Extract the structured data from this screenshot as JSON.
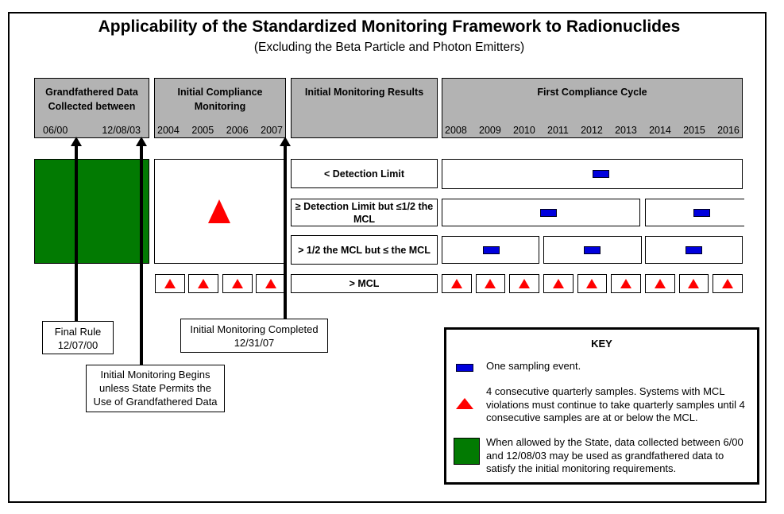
{
  "title": "Applicability of the Standardized Monitoring Framework to Radionuclides",
  "subtitle": "(Excluding the Beta Particle and Photon Emitters)",
  "headers": {
    "grandfathered": {
      "label": "Grandfathered Data Collected between",
      "dates": [
        "06/00",
        "12/08/03"
      ]
    },
    "initial_compliance": {
      "label": "Initial Compliance Monitoring",
      "years": [
        "2004",
        "2005",
        "2006",
        "2007"
      ]
    },
    "initial_results": {
      "label": "Initial Monitoring Results"
    },
    "first_cycle": {
      "label": "First Compliance Cycle",
      "years": [
        "2008",
        "2009",
        "2010",
        "2011",
        "2012",
        "2013",
        "2014",
        "2015",
        "2016"
      ]
    }
  },
  "rows": [
    {
      "label": "< Detection Limit",
      "periods": 1,
      "marker": "one-sampling-event"
    },
    {
      "label": "≥ Detection Limit but ≤1/2 the MCL",
      "periods": 2,
      "marker": "one-sampling-event"
    },
    {
      "label": "> 1/2 the MCL but ≤ the MCL",
      "periods": 3,
      "marker": "one-sampling-event"
    },
    {
      "label": "> MCL",
      "periods": 9,
      "marker": "quarterly-samples"
    }
  ],
  "callouts": {
    "final_rule": "Final Rule\n12/07/00",
    "initial_begins": "Initial Monitoring Begins unless State Permits the Use of Grandfathered Data",
    "initial_completed": "Initial Monitoring Completed\n12/31/07"
  },
  "key": {
    "title": "KEY",
    "items": [
      {
        "symbol": "blue-rectangle",
        "text": "One sampling event."
      },
      {
        "symbol": "red-triangle",
        "text": "4 consecutive quarterly samples.  Systems with MCL violations must continue to take quarterly samples until 4 consecutive samples are at or below the MCL."
      },
      {
        "symbol": "green-square",
        "text": "When allowed by the State, data collected between 6/00 and 12/08/03 may be used as grandfathered data to satisfy the initial monitoring requirements."
      }
    ]
  },
  "colors": {
    "sampling_event": "#0000dd",
    "quarterly": "#ff0000",
    "grandfathered": "#027a02",
    "header_bg": "#b3b3b3"
  }
}
